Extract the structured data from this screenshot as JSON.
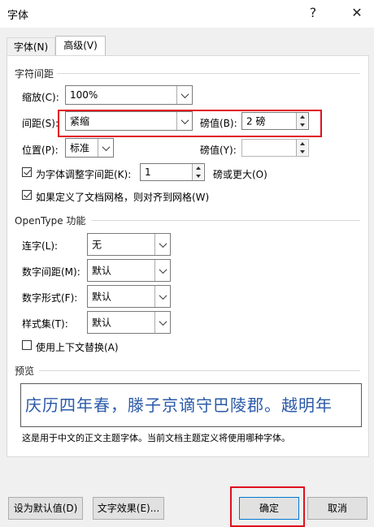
{
  "window": {
    "title": "字体",
    "help_glyph": "?",
    "close_glyph": "✕"
  },
  "tabs": [
    {
      "label": "字体(N)",
      "active": false
    },
    {
      "label": "高级(V)",
      "active": true
    }
  ],
  "char_spacing": {
    "section_title": "字符间距",
    "scale": {
      "label": "缩放(C):",
      "value": "100%"
    },
    "spacing": {
      "label": "间距(S):",
      "value": "紧缩",
      "by_label": "磅值(B):",
      "by_value": "2 磅"
    },
    "position": {
      "label": "位置(P):",
      "value": "标准",
      "by_label": "磅值(Y):",
      "by_value": ""
    },
    "kerning": {
      "label": "为字体调整字间距(K):",
      "value": "1",
      "suffix": "磅或更大(O)",
      "checked": true
    },
    "snap_grid": {
      "label": "如果定义了文档网格，则对齐到网格(W)",
      "checked": true
    }
  },
  "opentype": {
    "section_title": "OpenType 功能",
    "ligatures": {
      "label": "连字(L):",
      "value": "无"
    },
    "number_spacing": {
      "label": "数字间距(M):",
      "value": "默认"
    },
    "number_forms": {
      "label": "数字形式(F):",
      "value": "默认"
    },
    "stylistic_sets": {
      "label": "样式集(T):",
      "value": "默认"
    },
    "contextual_alternates": {
      "label": "使用上下文替换(A)",
      "checked": false
    }
  },
  "preview": {
    "section_title": "预览",
    "sample_text": "庆历四年春，滕子京谪守巴陵郡。越明年",
    "note": "这是用于中文的正文主题字体。当前文档主题定义将使用哪种字体。"
  },
  "buttons": {
    "set_default": "设为默认值(D)",
    "text_effects": "文字效果(E)...",
    "ok": "确定",
    "cancel": "取消"
  },
  "colors": {
    "highlight": "#e0101e",
    "preview_text": "#2b5aa8",
    "dialog_bg": "#f0f0f0"
  }
}
